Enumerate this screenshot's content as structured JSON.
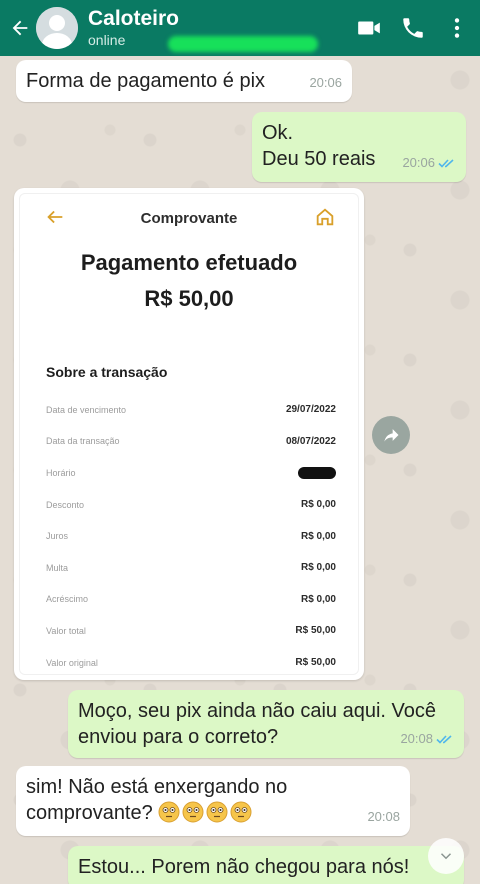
{
  "header": {
    "contact_name": "Caloteiro",
    "status": "online",
    "icons": [
      "back-arrow-icon",
      "video-call-icon",
      "phone-icon",
      "more-vert-icon"
    ],
    "color": "#0a7a63"
  },
  "messages": [
    {
      "dir": "in",
      "text": "Forma de pagamento é pix",
      "time": "20:06"
    },
    {
      "dir": "out",
      "lines": [
        "Ok.",
        "Deu 50 reais"
      ],
      "time": "20:06",
      "read": true
    },
    {
      "dir": "in",
      "type": "image-receipt"
    },
    {
      "dir": "out",
      "lines": [
        "Moço, seu pix ainda não caiu aqui. Você",
        "enviou para o correto?"
      ],
      "time": "20:08",
      "read": true
    },
    {
      "dir": "in",
      "lines": [
        "sim! Não está enxergando no",
        "comprovante?"
      ],
      "emoji_count": 4,
      "time": "20:08"
    },
    {
      "dir": "out",
      "text": "Estou... Porem não chegou para nós!"
    }
  ],
  "receipt": {
    "title": "Comprovante",
    "heading": "Pagamento efetuado",
    "amount": "R$ 50,00",
    "section": "Sobre a transação",
    "rows": [
      {
        "label": "Data de vencimento",
        "value": "29/07/2022"
      },
      {
        "label": "Data da transação",
        "value": "08/07/2022"
      },
      {
        "label": "Horário",
        "value": "",
        "redacted": true
      },
      {
        "label": "Desconto",
        "value": "R$ 0,00"
      },
      {
        "label": "Juros",
        "value": "R$ 0,00"
      },
      {
        "label": "Multa",
        "value": "R$ 0,00"
      },
      {
        "label": "Acréscimo",
        "value": "R$ 0,00"
      },
      {
        "label": "Valor total",
        "value": "R$ 50,00"
      },
      {
        "label": "Valor original",
        "value": "R$ 50,00"
      }
    ],
    "accent": "#d9a02a"
  },
  "colors": {
    "bubble_in": "#ffffff",
    "bubble_out": "#dcf8c6",
    "read_ticks": "#4fb6ec"
  }
}
